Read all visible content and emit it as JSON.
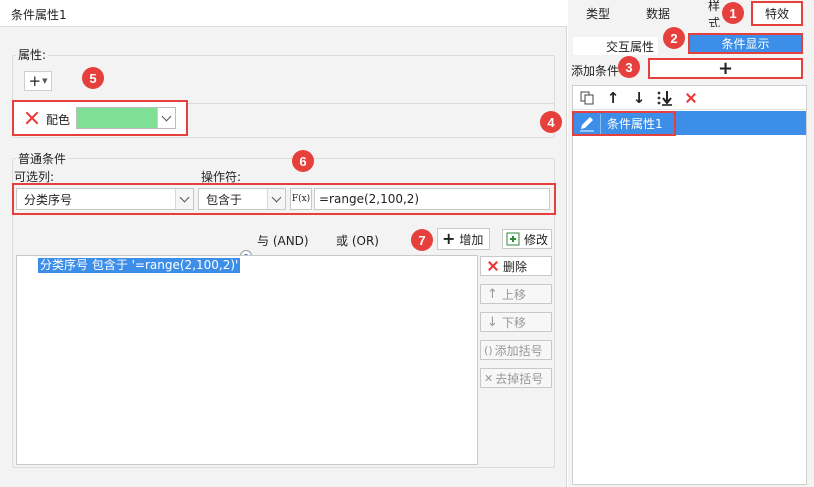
{
  "dialog": {
    "title": "条件属性1",
    "attribute_group": {
      "label": "属性:",
      "add_button": "+"
    },
    "color_attribute": {
      "label": "配色",
      "color": "#7ee095"
    },
    "condition_group": {
      "label": "普通条件",
      "column_label": "可选列:",
      "operator_label": "操作符:",
      "column_value": "分类序号",
      "operator_value": "包含于",
      "formula_button": "F(x)",
      "formula_value": "=range(2,100,2)",
      "and_label": "与 (AND)",
      "or_label": "或 (OR)",
      "add_button": "增加",
      "modify_button": "修改",
      "conditions": [
        "分类序号 包含于 '=range(2,100,2)'"
      ],
      "side_buttons": {
        "delete": "删除",
        "move_up": "上移",
        "move_down": "下移",
        "add_brackets": "添加括号",
        "remove_brackets": "去掉括号"
      }
    }
  },
  "right_panel": {
    "tabs": [
      "类型",
      "数据",
      "样式",
      "特效"
    ],
    "subtabs": [
      "交互属性",
      "条件显示"
    ],
    "add_condition_label": "添加条件",
    "add_condition_button": "+",
    "list": [
      "条件属性1"
    ]
  },
  "callouts": [
    "1",
    "2",
    "3",
    "4",
    "5",
    "6",
    "7"
  ],
  "colors": {
    "accent": "#3c8ee8",
    "callout": "#e5403c",
    "highlight": "#3c8ee8"
  }
}
